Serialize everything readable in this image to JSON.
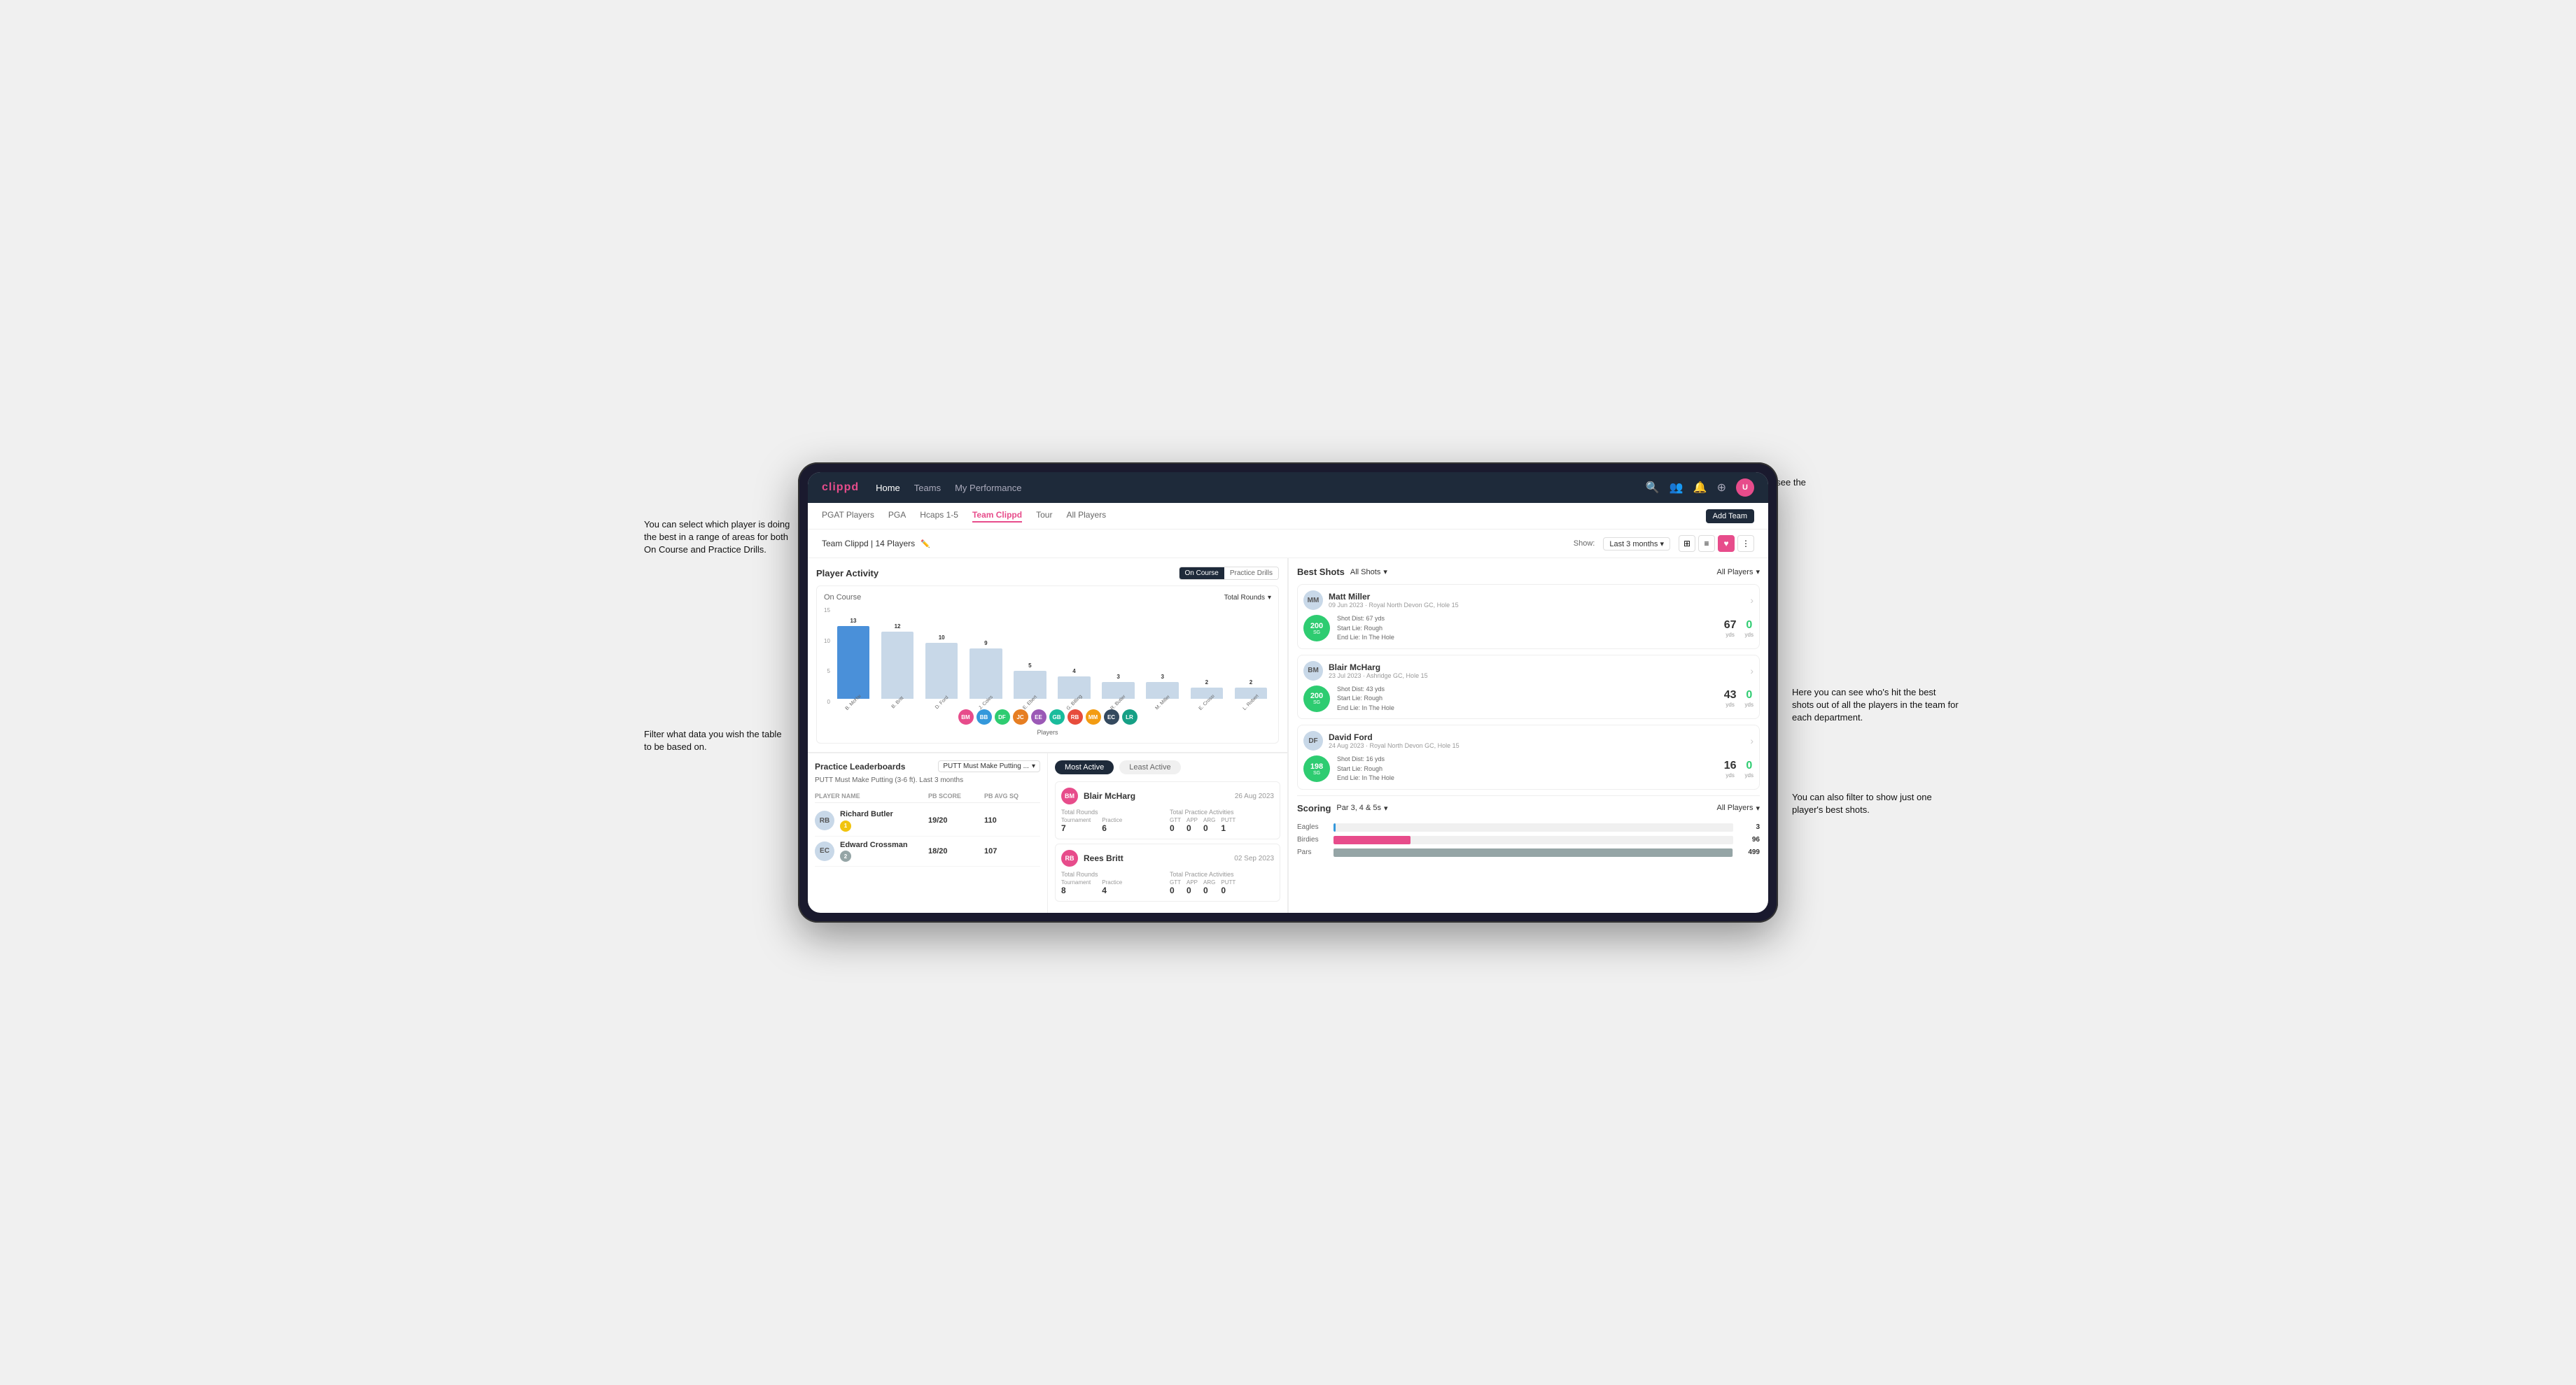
{
  "annotations": {
    "top_right": "Choose the timescale you wish to see the data over.",
    "left_top": "You can select which player is doing the best in a range of areas for both On Course and Practice Drills.",
    "left_bottom": "Filter what data you wish the table to be based on.",
    "right_mid": "Here you can see who's hit the best shots out of all the players in the team for each department.",
    "right_bottom": "You can also filter to show just one player's best shots."
  },
  "nav": {
    "logo": "clippd",
    "links": [
      "Home",
      "Teams",
      "My Performance"
    ],
    "icons": [
      "search",
      "users",
      "bell",
      "add",
      "avatar"
    ]
  },
  "sub_nav": {
    "tabs": [
      "PGAT Players",
      "PGA",
      "Hcaps 1-5",
      "Team Clippd",
      "Tour",
      "All Players"
    ],
    "active_tab": "Team Clippd",
    "add_button": "Add Team"
  },
  "team_header": {
    "name": "Team Clippd | 14 Players",
    "show_label": "Show:",
    "time_filter": "Last 3 months",
    "view_modes": [
      "grid",
      "list",
      "heart",
      "settings"
    ]
  },
  "player_activity": {
    "title": "Player Activity",
    "toggle_options": [
      "On Course",
      "Practice Drills"
    ],
    "active_toggle": "On Course",
    "chart_subtitle": "On Course",
    "chart_dropdown": "Total Rounds",
    "y_axis_labels": [
      "15",
      "10",
      "5",
      "0"
    ],
    "y_axis_title": "Total Rounds",
    "bars": [
      {
        "label": "B. McHarg",
        "value": 13,
        "highlighted": true
      },
      {
        "label": "B. Britt",
        "value": 12,
        "highlighted": false
      },
      {
        "label": "D. Ford",
        "value": 10,
        "highlighted": false
      },
      {
        "label": "J. Coles",
        "value": 9,
        "highlighted": false
      },
      {
        "label": "E. Ebert",
        "value": 5,
        "highlighted": false
      },
      {
        "label": "G. Billingham",
        "value": 4,
        "highlighted": false
      },
      {
        "label": "R. Butler",
        "value": 3,
        "highlighted": false
      },
      {
        "label": "M. Miller",
        "value": 3,
        "highlighted": false
      },
      {
        "label": "E. Crossman",
        "value": 2,
        "highlighted": false
      },
      {
        "label": "L. Robertson",
        "value": 2,
        "highlighted": false
      }
    ],
    "x_axis_label": "Players",
    "avatars": [
      "BM",
      "BB",
      "DF",
      "JC",
      "EE",
      "GB",
      "RB",
      "MM",
      "EC",
      "LR"
    ]
  },
  "practice_leaderboards": {
    "title": "Practice Leaderboards",
    "dropdown": "PUTT Must Make Putting ...",
    "subtitle": "PUTT Must Make Putting (3-6 ft). Last 3 months",
    "headers": [
      "PLAYER NAME",
      "PB SCORE",
      "PB AVG SQ"
    ],
    "players": [
      {
        "name": "Richard Butler",
        "rank": 1,
        "pb_score": "19/20",
        "pb_avg_sq": "110",
        "badge_type": "gold"
      },
      {
        "name": "Edward Crossman",
        "rank": 2,
        "pb_score": "18/20",
        "pb_avg_sq": "107",
        "badge_type": "silver"
      }
    ]
  },
  "most_active": {
    "active_label": "Most Active",
    "inactive_label": "Least Active",
    "players": [
      {
        "name": "Blair McHarg",
        "date": "26 Aug 2023",
        "total_rounds_label": "Total Rounds",
        "tournament": "7",
        "practice": "6",
        "total_practice_label": "Total Practice Activities",
        "gtt": "0",
        "app": "0",
        "arg": "0",
        "putt": "1"
      },
      {
        "name": "Rees Britt",
        "date": "02 Sep 2023",
        "total_rounds_label": "Total Rounds",
        "tournament": "8",
        "practice": "4",
        "total_practice_label": "Total Practice Activities",
        "gtt": "0",
        "app": "0",
        "arg": "0",
        "putt": "0"
      }
    ]
  },
  "best_shots": {
    "title": "Best Shots",
    "shots_filter": "All Shots",
    "players_filter": "All Players",
    "players": [
      {
        "name": "Matt Miller",
        "date": "09 Jun 2023",
        "course": "Royal North Devon GC",
        "hole": "Hole 15",
        "badge": "200",
        "badge_sub": "SG",
        "shot_dist": "Shot Dist: 67 yds",
        "start_lie": "Start Lie: Rough",
        "end_lie": "End Lie: In The Hole",
        "yds_value": "67",
        "yds_label": "yds",
        "zero_value": "0",
        "zero_label": "yds"
      },
      {
        "name": "Blair McHarg",
        "date": "23 Jul 2023",
        "course": "Ashridge GC",
        "hole": "Hole 15",
        "badge": "200",
        "badge_sub": "SG",
        "shot_dist": "Shot Dist: 43 yds",
        "start_lie": "Start Lie: Rough",
        "end_lie": "End Lie: In The Hole",
        "yds_value": "43",
        "yds_label": "yds",
        "zero_value": "0",
        "zero_label": "yds"
      },
      {
        "name": "David Ford",
        "date": "24 Aug 2023",
        "course": "Royal North Devon GC",
        "hole": "Hole 15",
        "badge": "198",
        "badge_sub": "SG",
        "shot_dist": "Shot Dist: 16 yds",
        "start_lie": "Start Lie: Rough",
        "end_lie": "End Lie: In The Hole",
        "yds_value": "16",
        "yds_label": "yds",
        "zero_value": "0",
        "zero_label": "yds"
      }
    ]
  },
  "scoring": {
    "title": "Scoring",
    "par_filter": "Par 3, 4 & 5s",
    "players_filter": "All Players",
    "rows": [
      {
        "label": "Eagles",
        "value": 3,
        "max": 500,
        "type": "eagles"
      },
      {
        "label": "Birdies",
        "value": 96,
        "max": 500,
        "type": "birdies"
      },
      {
        "label": "Pars",
        "value": 499,
        "max": 500,
        "type": "pars"
      }
    ]
  }
}
